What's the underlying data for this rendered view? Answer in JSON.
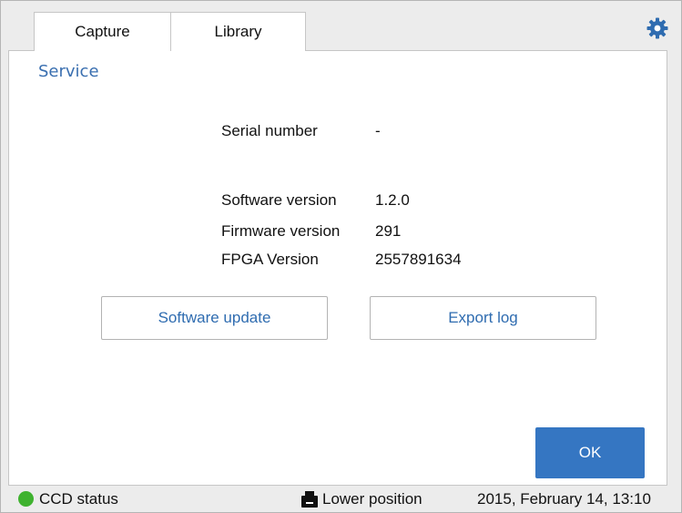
{
  "tabs": [
    {
      "label": "Capture"
    },
    {
      "label": "Library"
    }
  ],
  "settings": {
    "icon": "gear-icon"
  },
  "service": {
    "title": "Service",
    "info": [
      {
        "label": "Serial number",
        "value": "-"
      },
      {
        "label": "Software version",
        "value": "1.2.0"
      },
      {
        "label": "Firmware version",
        "value": "291"
      },
      {
        "label": "FPGA Version",
        "value": "2557891634"
      }
    ],
    "buttons": {
      "software_update": "Software update",
      "export_log": "Export log",
      "ok": "OK"
    }
  },
  "status_bar": {
    "ccd_status": "CCD status",
    "ccd_color": "#3fb22f",
    "position": "Lower position",
    "position_icon": "printer-icon",
    "datetime": "2015, February 14, 13:10"
  },
  "colors": {
    "accent": "#3576c2",
    "title": "#3a6fb0"
  }
}
